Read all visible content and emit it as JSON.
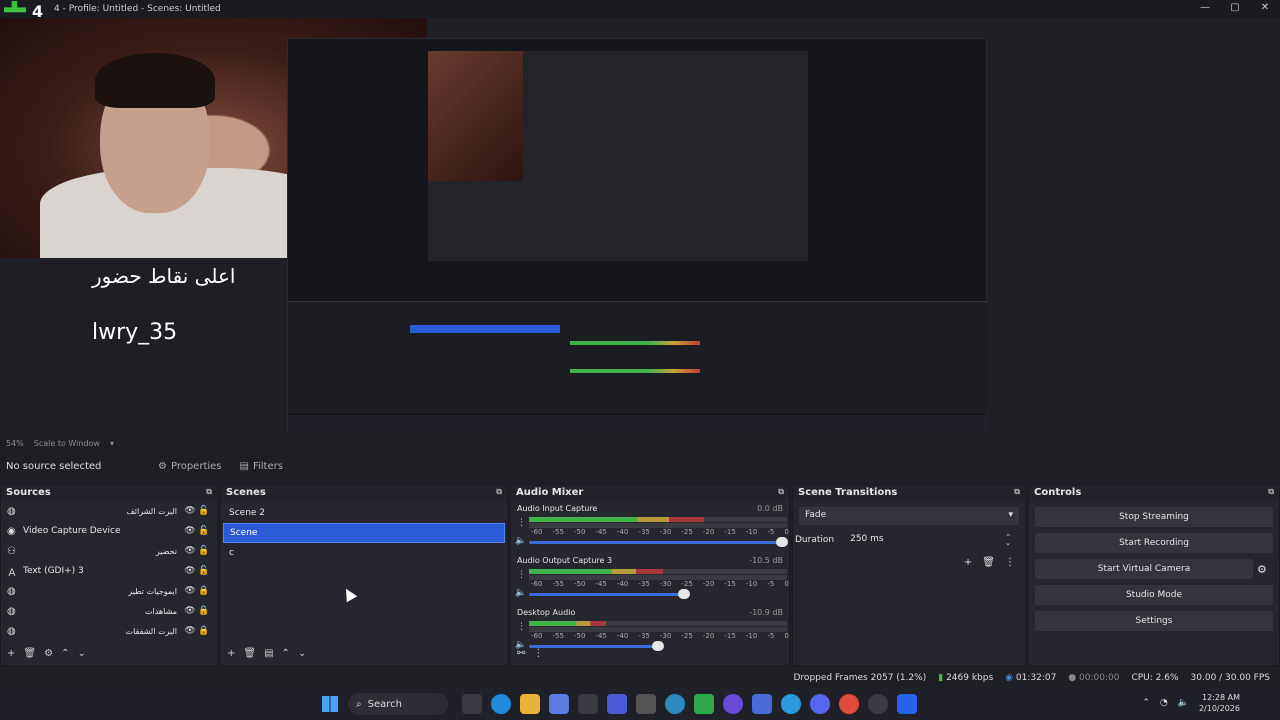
{
  "window": {
    "title": "4 - Profile: Untitled - Scenes: Untitled",
    "badge": "4",
    "buttons": [
      "—",
      "▢",
      "✕"
    ]
  },
  "overlay": {
    "title": "اعلى نقاط حضور",
    "username": "lwry_35"
  },
  "preview_bar": {
    "zoom": "54%",
    "scale_mode": "Scale to Window"
  },
  "context_bar": {
    "no_source": "No source selected",
    "properties": "Properties",
    "filters": "Filters"
  },
  "sources": {
    "title": "Sources",
    "items": [
      {
        "name": "البرت الشرائف",
        "icon": "globe-icon",
        "rtl": true,
        "locked": false
      },
      {
        "name": "Video Capture Device",
        "icon": "camera-icon",
        "rtl": false,
        "locked": false
      },
      {
        "name": "تحضير",
        "icon": "group-icon",
        "rtl": true,
        "locked": false
      },
      {
        "name": "Text (GDI+) 3",
        "icon": "text-icon",
        "rtl": false,
        "locked": false
      },
      {
        "name": "ايموجيات تطير",
        "icon": "globe-icon",
        "rtl": true,
        "locked": true
      },
      {
        "name": "مشاهدات",
        "icon": "globe-icon",
        "rtl": true,
        "locked": true
      },
      {
        "name": "البرت الشفقات",
        "icon": "globe-icon",
        "rtl": true,
        "locked": true
      }
    ]
  },
  "scenes": {
    "title": "Scenes",
    "items": [
      {
        "name": "Scene 2",
        "selected": false
      },
      {
        "name": "Scene",
        "selected": true
      },
      {
        "name": "c",
        "selected": false
      }
    ]
  },
  "mixer": {
    "title": "Audio Mixer",
    "channels": [
      {
        "name": "Audio Input Capture",
        "db": "0.0 dB",
        "level": 0.68,
        "volume": 0.98
      },
      {
        "name": "Audio Output Capture 3",
        "db": "-10.5 dB",
        "level": 0.52,
        "volume": 0.6
      },
      {
        "name": "Desktop Audio",
        "db": "-10.9 dB",
        "level": 0.3,
        "volume": 0.5
      }
    ],
    "scale": [
      "-60",
      "-55",
      "-50",
      "-45",
      "-40",
      "-35",
      "-30",
      "-25",
      "-20",
      "-15",
      "-10",
      "-5",
      "0"
    ]
  },
  "transitions": {
    "title": "Scene Transitions",
    "selected": "Fade",
    "duration_label": "Duration",
    "duration_value": "250 ms"
  },
  "controls": {
    "title": "Controls",
    "buttons": [
      "Stop Streaming",
      "Start Recording",
      "Start Virtual Camera",
      "Studio Mode",
      "Settings"
    ]
  },
  "status": {
    "dropped": "Dropped Frames 2057 (1.2%)",
    "bitrate": "2469 kbps",
    "stream_time": "01:32:07",
    "rec_time": "00:00:00",
    "cpu": "CPU: 2.6%",
    "fps": "30.00 / 30.00 FPS"
  },
  "taskbar": {
    "search": "Search",
    "time": "12:28 AM",
    "date": "2/10/2026"
  },
  "colors": {
    "accent": "#2b5bd6",
    "meter_green": "#3fb34a",
    "meter_yellow": "#b79a3c",
    "meter_red": "#a8363c"
  }
}
